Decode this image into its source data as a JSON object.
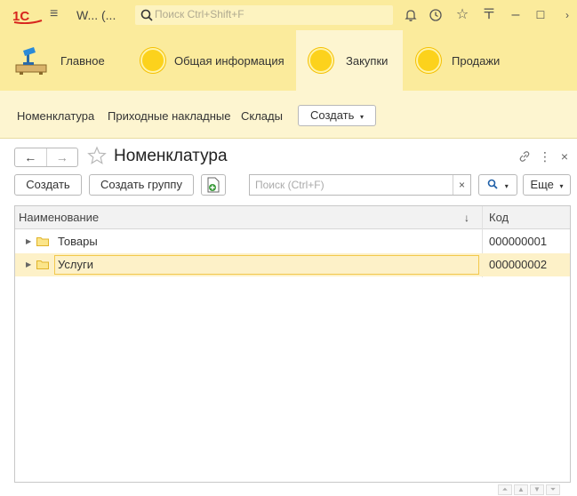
{
  "titlebar": {
    "title": "W... (...",
    "search_placeholder": "Поиск Ctrl+Shift+F",
    "icons": [
      "menu-icon",
      "bell-icon",
      "history-icon",
      "star-icon",
      "more-icon",
      "minimize-icon",
      "maximize-icon",
      "close-icon"
    ]
  },
  "sections": {
    "items": [
      {
        "label": "Главное"
      },
      {
        "label": "Общая информация"
      },
      {
        "label": "Закупки"
      },
      {
        "label": "Продажи"
      }
    ],
    "active": "Закупки"
  },
  "function_panel": {
    "links": [
      "Номенклатура",
      "Приходные накладные",
      "Склады"
    ],
    "create_label": "Создать"
  },
  "form": {
    "title": "Номенклатура",
    "back_label": "←",
    "forward_label": "→"
  },
  "commands": {
    "create_label": "Создать",
    "create_group_label": "Создать группу",
    "search_placeholder": "Поиск (Ctrl+F)",
    "more_label": "Еще"
  },
  "table": {
    "columns": [
      "Наименование",
      "Код"
    ],
    "rows": [
      {
        "name": "Товары",
        "code": "000000001"
      },
      {
        "name": "Услуги",
        "code": "000000002"
      }
    ],
    "selected_row": 1
  },
  "colors": {
    "accent_yellow": "#fbeb9c",
    "section_circle": "#fcd21c",
    "selection": "#fdf1c8"
  }
}
